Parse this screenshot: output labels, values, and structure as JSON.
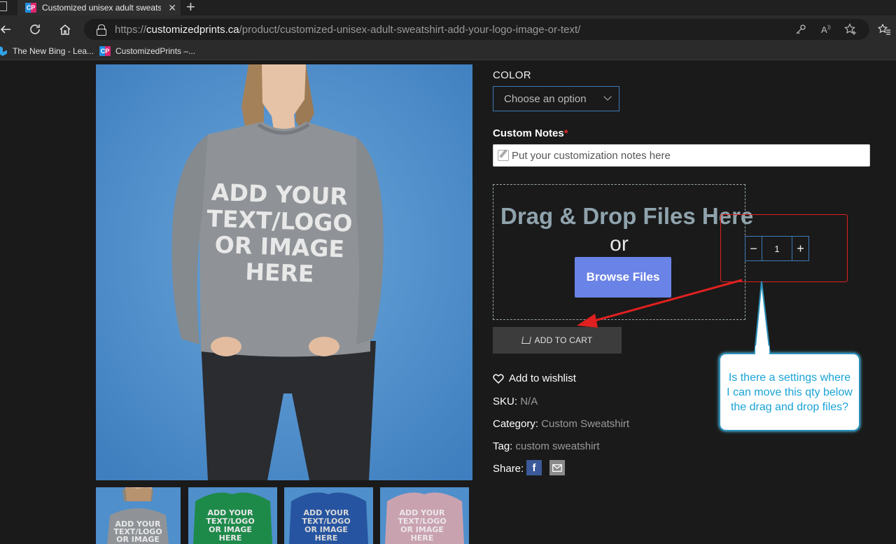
{
  "browser": {
    "tab_title": "Customized unisex adult sweatshirt",
    "tab_close": "✕",
    "url_scheme": "https://",
    "url_host": "customizedprints.ca",
    "url_path": "/product/customized-unisex-adult-sweatshirt-add-your-logo-image-or-text/",
    "bookmarks": [
      "The New Bing - Lea...",
      "CustomizedPrints –..."
    ]
  },
  "product_image": {
    "print_text": [
      "ADD YOUR",
      "TEXT/LOGO",
      "OR IMAGE",
      "HERE"
    ],
    "thumbnails": [
      {
        "color": "#8f9295",
        "text": [
          "ADD YOUR",
          "TEXT/LOGO",
          "OR IMAGE"
        ]
      },
      {
        "color": "#1e8a4a",
        "text": [
          "ADD YOUR",
          "TEXT/LOGO",
          "OR IMAGE",
          "HERE"
        ]
      },
      {
        "color": "#2654a0",
        "text": [
          "ADD YOUR",
          "TEXT/LOGO",
          "OR IMAGE",
          "HERE"
        ]
      },
      {
        "color": "#c9a2b0",
        "text": [
          "ADD YOUR",
          "TEXT/LOGO",
          "OR IMAGE",
          "HERE"
        ]
      }
    ]
  },
  "form": {
    "color_label": "COLOR",
    "color_select": "Choose an option",
    "notes_label": "Custom Notes",
    "notes_required": "*",
    "notes_placeholder": "Put your customization notes here",
    "drop_title": "Drag & Drop Files Here",
    "drop_or": "or",
    "browse_label": "Browse Files",
    "qty_minus": "−",
    "qty_value": "1",
    "qty_plus": "+",
    "add_to_cart": "ADD TO CART"
  },
  "meta": {
    "wishlist": "Add to wishlist",
    "sku_label": "SKU:",
    "sku_value": "N/A",
    "category_label": "Category:",
    "category_value": "Custom Sweatshirt",
    "tag_label": "Tag:",
    "tag_value": "custom sweatshirt",
    "share_label": "Share:",
    "facebook": "f"
  },
  "annotation": {
    "callout_text": "Is there a settings where I can move this qty below the drag and drop files?"
  },
  "colors": {
    "accent_blue": "#3e7bb7",
    "browse_button": "#6a83e6",
    "annotation_red": "#e02020",
    "callout_text": "#1aa3d6"
  }
}
